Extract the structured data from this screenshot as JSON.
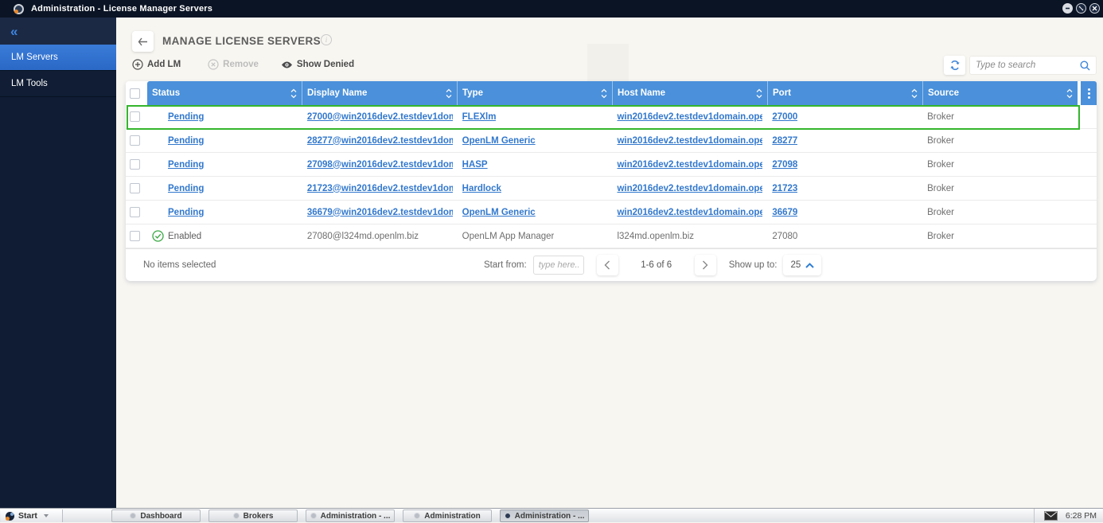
{
  "titlebar": {
    "title": "Administration - License Manager Servers"
  },
  "sidebar": {
    "collapse_glyph": "«",
    "items": [
      {
        "label": "LM Servers"
      },
      {
        "label": "LM Tools"
      }
    ]
  },
  "page": {
    "title": "MANAGE LICENSE SERVERS",
    "info_glyph": "i"
  },
  "toolbar": {
    "add_label": "Add LM",
    "remove_label": "Remove",
    "show_denied_label": "Show Denied",
    "search_placeholder": "Type to search"
  },
  "table": {
    "columns": [
      "Status",
      "Display Name",
      "Type",
      "Host Name",
      "Port",
      "Source"
    ],
    "rows": [
      {
        "status": "Pending",
        "display_name": "27000@win2016dev2.testdev1dom...",
        "type": "FLEXlm",
        "host_name": "win2016dev2.testdev1domain.ope...",
        "port": "27000",
        "source": "Broker"
      },
      {
        "status": "Pending",
        "display_name": "28277@win2016dev2.testdev1dom...",
        "type": "OpenLM Generic",
        "host_name": "win2016dev2.testdev1domain.ope...",
        "port": "28277",
        "source": "Broker"
      },
      {
        "status": "Pending",
        "display_name": "27098@win2016dev2.testdev1dom...",
        "type": "HASP",
        "host_name": "win2016dev2.testdev1domain.ope...",
        "port": "27098",
        "source": "Broker"
      },
      {
        "status": "Pending",
        "display_name": "21723@win2016dev2.testdev1dom...",
        "type": "Hardlock",
        "host_name": "win2016dev2.testdev1domain.ope...",
        "port": "21723",
        "source": "Broker"
      },
      {
        "status": "Pending",
        "display_name": "36679@win2016dev2.testdev1dom...",
        "type": "OpenLM Generic",
        "host_name": "win2016dev2.testdev1domain.ope...",
        "port": "36679",
        "source": "Broker"
      },
      {
        "status": "Enabled",
        "display_name": "27080@l324md.openlm.biz",
        "type": "OpenLM App Manager",
        "host_name": "l324md.openlm.biz",
        "port": "27080",
        "source": "Broker"
      }
    ]
  },
  "footer": {
    "selection": "No items selected",
    "start_from_label": "Start from:",
    "start_from_placeholder": "type here..",
    "range": "1-6 of 6",
    "show_up_to_label": "Show up to:",
    "page_size": "25"
  },
  "taskbar": {
    "start_label": "Start",
    "windows": [
      {
        "label": "Dashboard"
      },
      {
        "label": "Brokers"
      },
      {
        "label": "Administration - ..."
      },
      {
        "label": "Administration"
      },
      {
        "label": "Administration - ..."
      }
    ],
    "time": "6:28 PM"
  },
  "colors": {
    "header_blue": "#4a90da",
    "link_blue": "#3278cd",
    "sidebar_navy": "#0f1c33",
    "selected_blue": "#2e71d3",
    "highlight_green": "#35b52d",
    "status_green": "#3aa845",
    "background_cream": "#f8f6f1"
  }
}
